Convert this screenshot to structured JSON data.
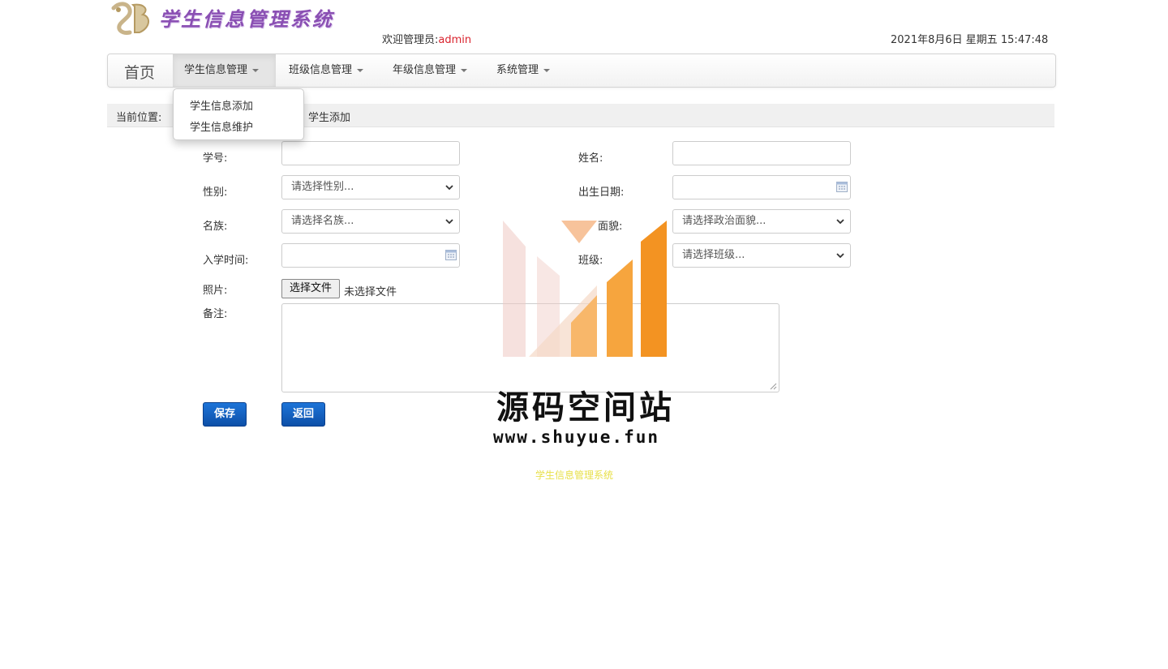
{
  "header": {
    "logo_text": "学生信息管理系统",
    "welcome_prefix": "欢迎管理员:",
    "username": "admin",
    "datetime": "2021年8月6日 星期五 15:47:48"
  },
  "nav": {
    "brand": "首页",
    "items": [
      {
        "label": "学生信息管理"
      },
      {
        "label": "班级信息管理"
      },
      {
        "label": "年级信息管理"
      },
      {
        "label": "系统管理"
      }
    ]
  },
  "dropdown": {
    "items": [
      {
        "label": "学生信息添加"
      },
      {
        "label": "学生信息维护"
      }
    ]
  },
  "breadcrumb": {
    "label": "当前位置:",
    "current": "学生添加"
  },
  "form": {
    "student_id_label": "学号:",
    "name_label": "姓名:",
    "gender_label": "性别:",
    "gender_placeholder": "请选择性别...",
    "birth_label": "出生日期:",
    "ethnicity_label": "名族:",
    "ethnicity_placeholder": "请选择名族...",
    "political_label": "面貌:",
    "political_placeholder": "请选择政治面貌...",
    "enroll_label": "入学时间:",
    "class_label": "班级:",
    "class_placeholder": "请选择班级...",
    "photo_label": "照片:",
    "file_button": "选择文件",
    "file_status": "未选择文件",
    "remark_label": "备注:",
    "save_button": "保存",
    "back_button": "返回"
  },
  "watermark": {
    "title": "源码空间站",
    "url": "www.shuyue.fun"
  },
  "footer": {
    "text": "学生信息管理系统"
  },
  "colors": {
    "accent_red": "#d9232e",
    "button_blue": "#0d4fa8",
    "logo_purple": "#8a4fb3",
    "watermark_orange": "#f39322",
    "footer_yellow": "#e8e04a"
  }
}
